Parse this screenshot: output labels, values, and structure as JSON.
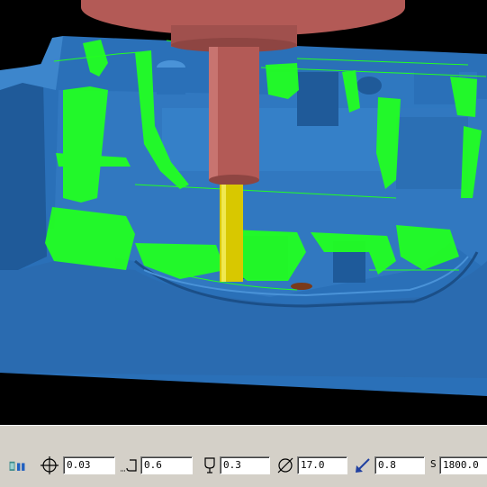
{
  "viewport": {
    "description_icons": [
      "milling-tool",
      "cut-part"
    ],
    "colors": {
      "background": "#000000",
      "part_blue": "#2f78c0",
      "part_blue_light": "#4a93d8",
      "part_blue_dark": "#1f5a99",
      "toolpath_green": "#22ff22",
      "spindle_red": "#b35a56",
      "tool_yellow": "#d8c800"
    }
  },
  "statusbar": {
    "fields": [
      {
        "icon": "tool-library-icon",
        "value": null
      },
      {
        "icon": "crosshair-icon",
        "value": "0.03"
      },
      {
        "icon": "corner-radius-icon",
        "value": "0.6"
      },
      {
        "icon": "tool-tip-icon",
        "value": "0.3"
      },
      {
        "icon": "diameter-icon",
        "value": "17.0"
      },
      {
        "icon": "feed-arrow-icon",
        "value": "0.8"
      },
      {
        "icon": "spindle-speed-icon",
        "label": "S",
        "value": "1800.0"
      }
    ]
  }
}
